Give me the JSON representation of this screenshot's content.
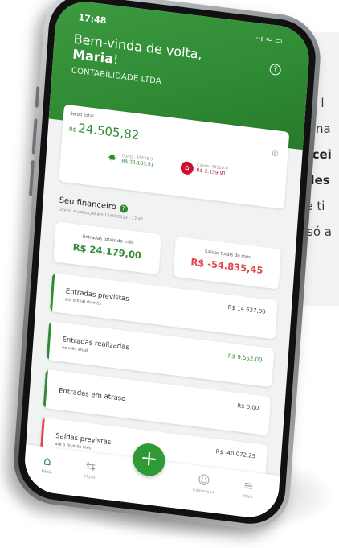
{
  "quote": {
    "lines": [
      {
        "text": "\"Muito l",
        "bold": false
      },
      {
        "text": "pequena",
        "bold": false
      },
      {
        "text": "financei",
        "bold": true
      },
      {
        "text": "simples",
        "bold": true
      },
      {
        "text": "desse ti",
        "bold": false
      },
      {
        "text": "nós, só a",
        "bold": false
      }
    ]
  },
  "status": {
    "time": "17:48",
    "icons": "··ı ≈ ▭"
  },
  "header": {
    "greeting": "Bem-vinda de volta,",
    "name": "Maria",
    "name_suffix": "!",
    "company": "CONTABILIDADE LTDA",
    "help_icon": "?"
  },
  "balance": {
    "label": "Saldo total",
    "currency": "R$",
    "value": "24.505,82",
    "eye_icon": "◎",
    "accounts": [
      {
        "label": "Conta: 45678-9",
        "value": "R$ 22.183,91",
        "icon": "✸",
        "color": "#2f8a34"
      },
      {
        "label": "Conta: 48110-0",
        "value": "R$ 2.159,91",
        "icon": "⌂",
        "color": "#c8102e"
      }
    ]
  },
  "financeiro": {
    "title": "Seu financeiro",
    "badge": "?",
    "updated": "Última atualização em 13/06/2023 - 17:47",
    "totals": [
      {
        "label": "Entradas totais do mês",
        "value": "R$ 24.179,00",
        "color": "#2f8a34"
      },
      {
        "label": "Saídas totais do mês",
        "value": "R$ -54.835,45",
        "color": "#e0484f"
      }
    ],
    "rows": [
      {
        "title": "Entradas previstas",
        "sub": "até o final do mês",
        "value": "R$ 14.627,00",
        "green": false,
        "red": false
      },
      {
        "title": "Entradas realizadas",
        "sub": "no mês atual",
        "value": "R$ 9.552,00",
        "green": true,
        "red": false
      },
      {
        "title": "Entradas em atraso",
        "sub": "",
        "value": "R$ 0,00",
        "green": false,
        "red": false
      },
      {
        "title": "Saídas previstas",
        "sub": "até o final do mês",
        "value": "R$ -40.072,25",
        "green": false,
        "red": true
      }
    ]
  },
  "nav": {
    "items": [
      {
        "label": "Início",
        "icon": "⌂",
        "active": true
      },
      {
        "label": "Fluxo",
        "icon": "⇆",
        "active": false
      },
      {
        "label": "Cobranças",
        "icon": "☺",
        "active": false
      },
      {
        "label": "Mais",
        "icon": "≡",
        "active": false
      }
    ],
    "fab": "+"
  }
}
